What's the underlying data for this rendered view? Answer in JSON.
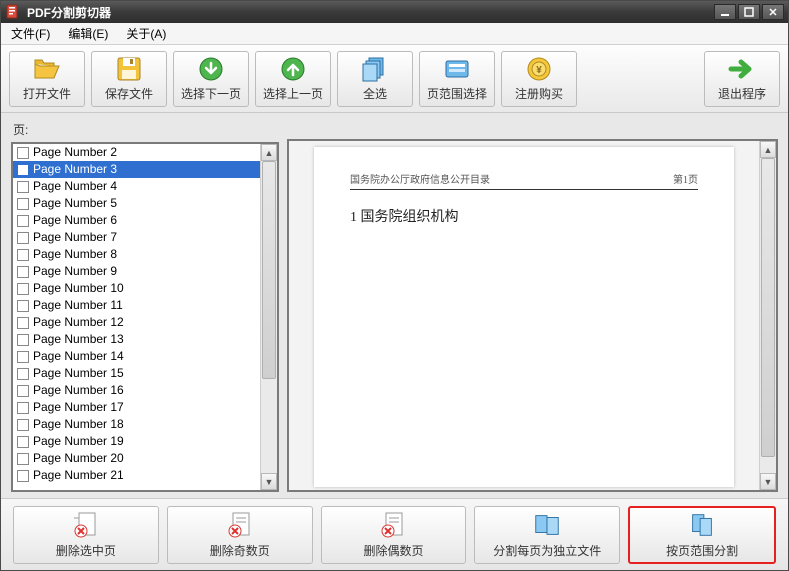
{
  "window": {
    "title": "PDF分割剪切器"
  },
  "menubar": {
    "file": "文件(F)",
    "edit": "编辑(E)",
    "about": "关于(A)"
  },
  "toolbar": {
    "open": "打开文件",
    "save": "保存文件",
    "select_next": "选择下一页",
    "select_prev": "选择上一页",
    "select_all": "全选",
    "page_range": "页范围选择",
    "register": "注册购买",
    "exit": "退出程序"
  },
  "pages_label": "页:",
  "pages": {
    "selected_index": 1,
    "items": [
      "Page Number 2",
      "Page Number 3",
      "Page Number 4",
      "Page Number 5",
      "Page Number 6",
      "Page Number 7",
      "Page Number 8",
      "Page Number 9",
      "Page Number 10",
      "Page Number 11",
      "Page Number 12",
      "Page Number 13",
      "Page Number 14",
      "Page Number 15",
      "Page Number 16",
      "Page Number 17",
      "Page Number 18",
      "Page Number 19",
      "Page Number 20",
      "Page Number 21"
    ]
  },
  "preview": {
    "header_left": "国务院办公厅政府信息公开目录",
    "header_right": "第1页",
    "section": "1  国务院组织机构"
  },
  "bottombar": {
    "delete_selected": "删除选中页",
    "delete_odd": "删除奇数页",
    "delete_even": "删除偶数页",
    "split_each": "分割每页为独立文件",
    "split_range": "按页范围分割"
  }
}
